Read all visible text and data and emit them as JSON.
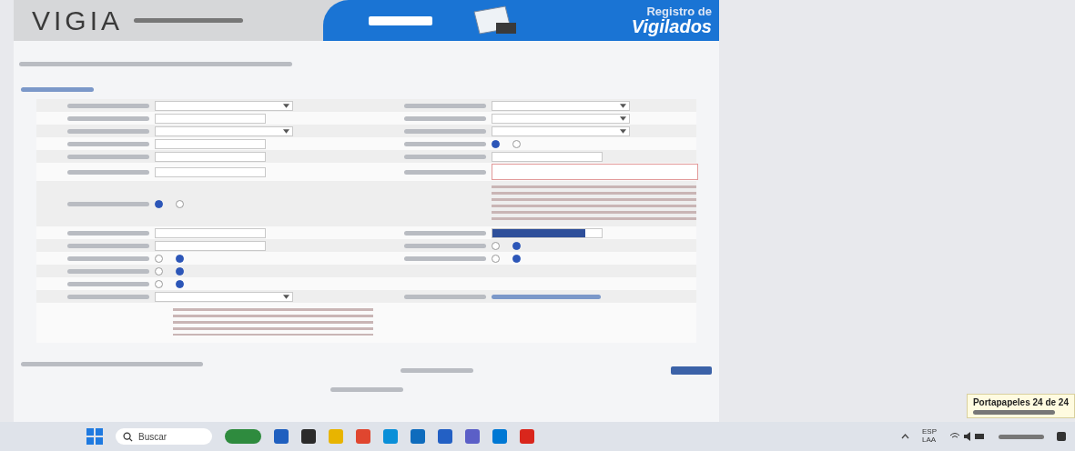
{
  "header": {
    "logo": "VIGIA",
    "banner_title": "Registro de",
    "banner_subtitle": "Vigilados"
  },
  "form_rows": [
    {
      "left": {
        "kind": "select"
      },
      "right": {
        "kind": "select"
      }
    },
    {
      "left": {
        "kind": "input"
      },
      "right": {
        "kind": "select"
      }
    },
    {
      "left": {
        "kind": "select"
      },
      "right": {
        "kind": "select"
      }
    },
    {
      "left": {
        "kind": "input"
      },
      "right": {
        "kind": "radio",
        "options": [
          {
            "selected": true
          },
          {
            "selected": false
          }
        ]
      }
    },
    {
      "left": {
        "kind": "input"
      },
      "right": {
        "kind": "input"
      }
    },
    {
      "left": {
        "kind": "input"
      },
      "right": {
        "kind": "textarea"
      }
    },
    {
      "left": {
        "kind": "radio",
        "options": [
          {
            "selected": true
          },
          {
            "selected": false
          }
        ]
      },
      "right": {
        "kind": "note"
      }
    },
    {
      "left": {
        "kind": "input"
      },
      "right": {
        "kind": "highlighted"
      }
    },
    {
      "left": {
        "kind": "input"
      },
      "right": {
        "kind": "radio",
        "options": [
          {
            "selected": false
          },
          {
            "selected": true
          }
        ]
      }
    },
    {
      "left": {
        "kind": "radio",
        "options": [
          {
            "selected": false
          },
          {
            "selected": true
          }
        ]
      },
      "right": {
        "kind": "radio",
        "options": [
          {
            "selected": false
          },
          {
            "selected": true
          }
        ]
      }
    },
    {
      "left": {
        "kind": "radio",
        "options": [
          {
            "selected": false
          },
          {
            "selected": true
          }
        ]
      },
      "right": {
        "kind": "empty"
      }
    },
    {
      "left": {
        "kind": "radio",
        "options": [
          {
            "selected": false
          },
          {
            "selected": true
          }
        ]
      },
      "right": {
        "kind": "empty"
      }
    },
    {
      "left": {
        "kind": "select"
      },
      "right": {
        "kind": "link"
      }
    }
  ],
  "taskbar": {
    "search_placeholder": "Buscar",
    "language": "ESP",
    "layout": "LAA"
  },
  "notification": {
    "title": "Portapapeles 24 de 24"
  }
}
